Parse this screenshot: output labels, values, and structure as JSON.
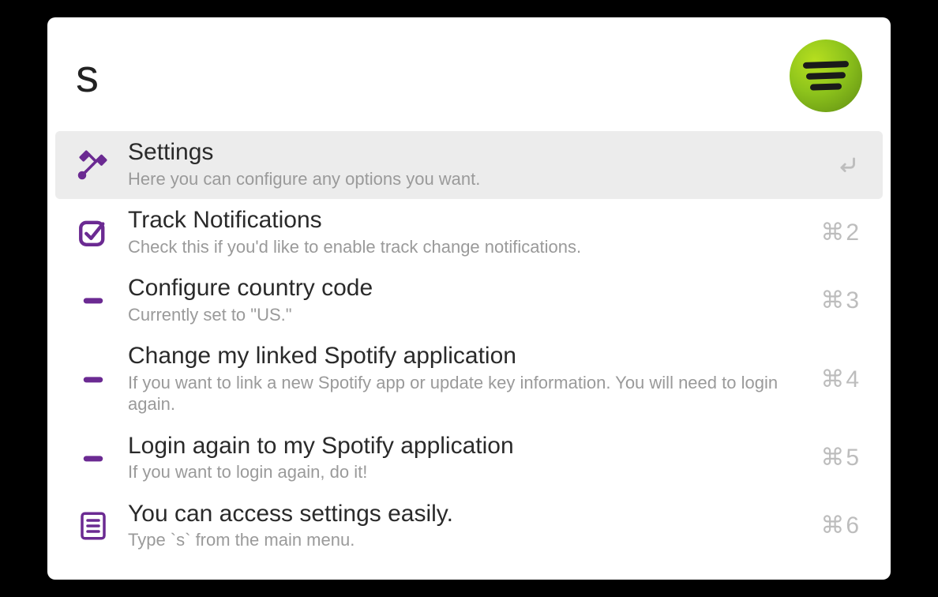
{
  "search": {
    "value": "s",
    "placeholder": ""
  },
  "header": {
    "icon_name": "spotify-logo"
  },
  "colors": {
    "accent": "#6b2a92",
    "spotify_green": "#8ec41c"
  },
  "results": [
    {
      "icon": "tools-icon",
      "title": "Settings",
      "subtitle": "Here you can configure any options you want.",
      "shortcut": "",
      "action_icon": "return-icon",
      "selected": true
    },
    {
      "icon": "checkbox-icon",
      "title": "Track Notifications",
      "subtitle": "Check this if you'd like to enable track change notifications.",
      "shortcut": "⌘2",
      "action_icon": "",
      "selected": false
    },
    {
      "icon": "minus-icon",
      "title": "Configure country code",
      "subtitle": "Currently set to \"US.\"",
      "shortcut": "⌘3",
      "action_icon": "",
      "selected": false
    },
    {
      "icon": "minus-icon",
      "title": "Change my linked Spotify application",
      "subtitle": "If you want to link a new Spotify app or update key information. You will need to login again.",
      "shortcut": "⌘4",
      "action_icon": "",
      "selected": false
    },
    {
      "icon": "minus-icon",
      "title": "Login again to my Spotify application",
      "subtitle": "If you want to login again, do it!",
      "shortcut": "⌘5",
      "action_icon": "",
      "selected": false
    },
    {
      "icon": "list-icon",
      "title": "You can access settings easily.",
      "subtitle": "Type `s` from the main menu.",
      "shortcut": "⌘6",
      "action_icon": "",
      "selected": false
    }
  ]
}
